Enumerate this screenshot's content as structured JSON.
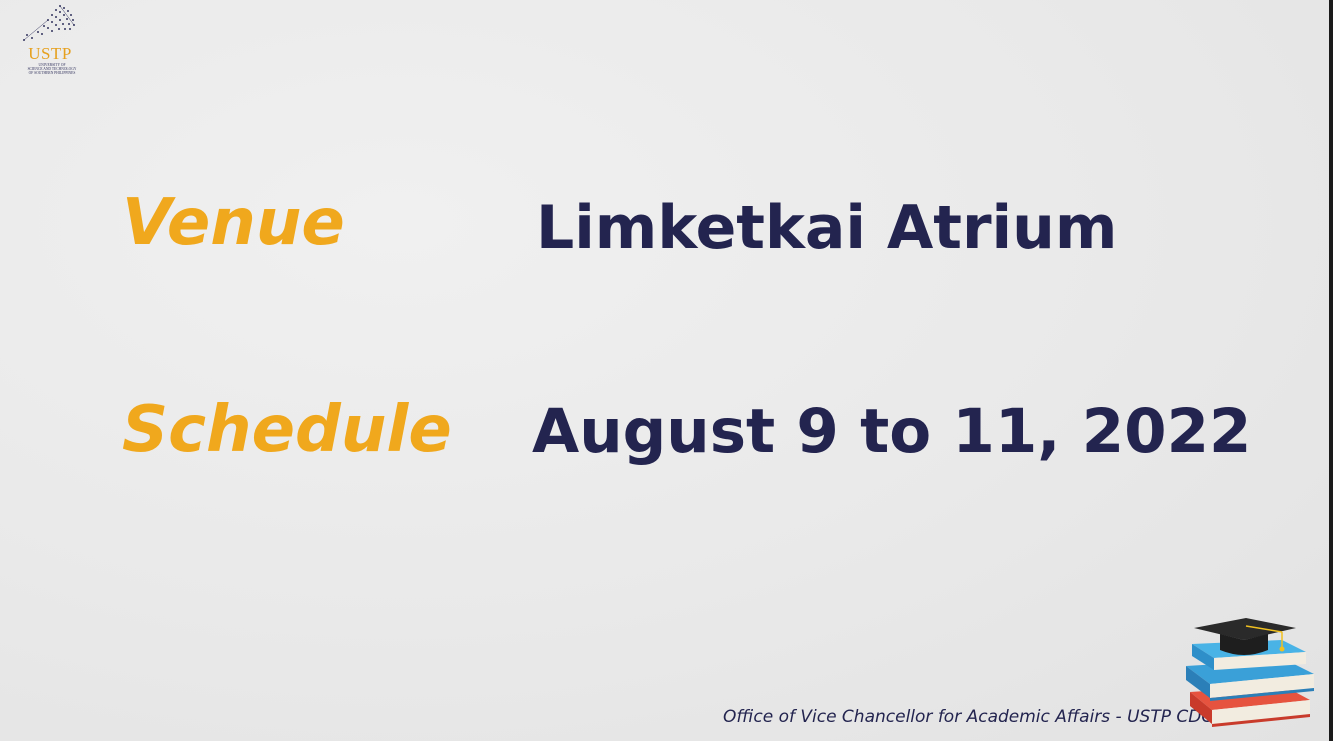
{
  "logo": {
    "name": "USTP",
    "subtitle_lines": [
      "UNIVERSITY OF",
      "SCIENCE AND TECHNOLOGY",
      "OF SOUTHERN PHILIPPINES"
    ]
  },
  "venue": {
    "label": "Venue",
    "value": "Limketkai Atrium"
  },
  "schedule": {
    "label": "Schedule",
    "value": "August 9 to 11, 2022"
  },
  "footer": {
    "text": "Office of Vice Chancellor for Academic Affairs - USTP CDO"
  },
  "colors": {
    "label": "#f0a81d",
    "value": "#23244f",
    "background": "#ebebeb"
  },
  "icons": {
    "logo": "ustp-logo-icon",
    "books": "books-graduation-cap-icon"
  }
}
